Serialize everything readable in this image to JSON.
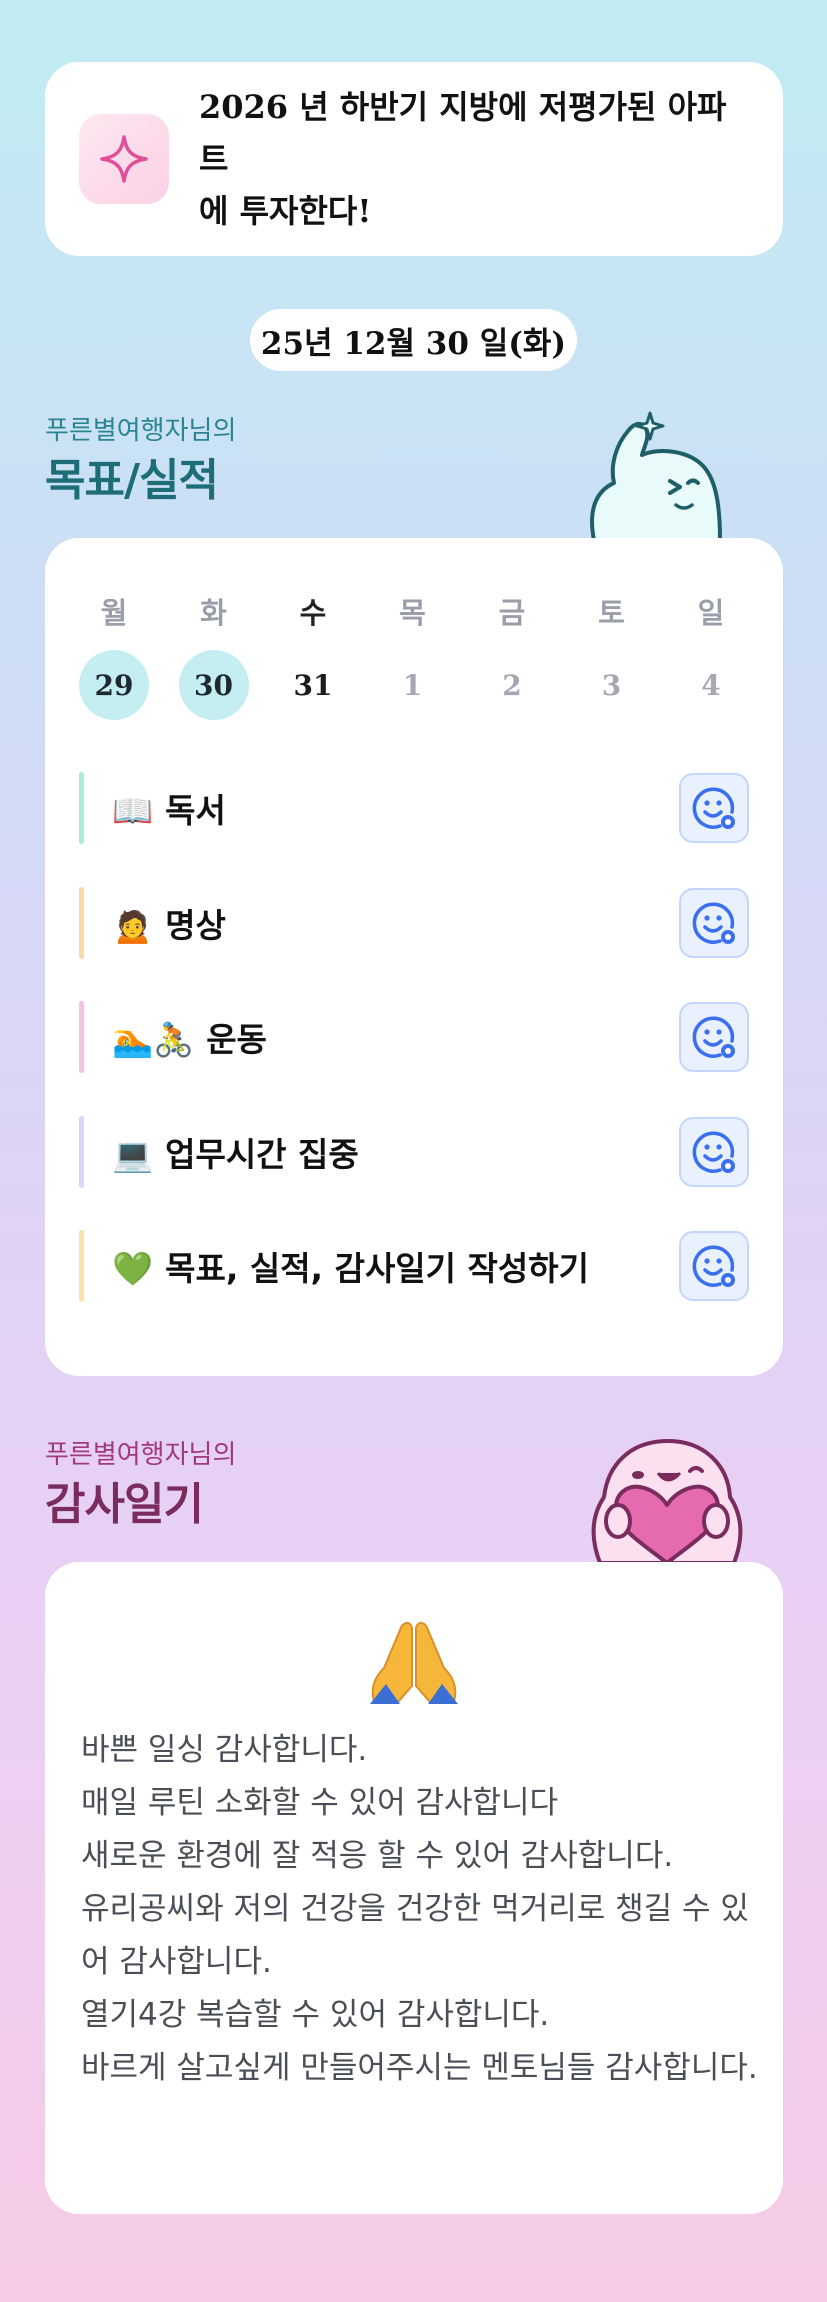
{
  "goal": {
    "icon": "sparkle-icon",
    "text_line1": "2026 년 하반기 지방에 저평가된 아파트",
    "text_line2": "에 투자한다!"
  },
  "date_label": "25년 12월 30 일(화)",
  "goals_section": {
    "subtitle": "푸른별여행자님의",
    "title": "목표/실적",
    "title_color": "#1d6d78"
  },
  "week": {
    "days": [
      {
        "label": "월",
        "date": "29",
        "state": "done"
      },
      {
        "label": "화",
        "date": "30",
        "state": "done"
      },
      {
        "label": "수",
        "date": "31",
        "state": "today"
      },
      {
        "label": "목",
        "date": "1",
        "state": "future"
      },
      {
        "label": "금",
        "date": "2",
        "state": "future"
      },
      {
        "label": "토",
        "date": "3",
        "state": "future"
      },
      {
        "label": "일",
        "date": "4",
        "state": "future"
      }
    ]
  },
  "tasks": [
    {
      "emoji": "📖",
      "label": "독서",
      "bar_color": "#a9ead8"
    },
    {
      "emoji": "🙍",
      "label": "명상",
      "bar_color": "#fbd8a5"
    },
    {
      "emoji": "🏊🚴",
      "label": "운동",
      "bar_color": "#f7c2e2"
    },
    {
      "emoji": "💻",
      "label": "업무시간 집중",
      "bar_color": "#d9d6f7"
    },
    {
      "emoji": "💚",
      "label": "목표, 실적, 감사일기 작성하기",
      "bar_color": "#fbe0a8"
    }
  ],
  "task_button_icon": "smiley-add-icon",
  "gratitude_section": {
    "subtitle": "푸른별여행자님의",
    "title": "감사일기",
    "title_color": "#7a2c5f",
    "emoji": "🙏",
    "lines": [
      "바쁜 일싱 감사합니다.",
      "매일 루틴 소화할 수 있어 감사합니다",
      "새로운 환경에 잘 적응 할 수 있어 감사합니다.",
      "유리공씨와 저의 건강을 건강한 먹거리로 챙길 수 있어 감사합니다.",
      "열기4강 복습할 수 있어 감사합니다.",
      "바르게 살고싶게 만들어주시는 멘토님들 감사합니다."
    ]
  },
  "colors": {
    "accent_teal": "#1d6d78",
    "accent_plum": "#7a2c5f",
    "done_day_bg": "#c5eef3",
    "task_button_blue": "#3a6ff0"
  }
}
